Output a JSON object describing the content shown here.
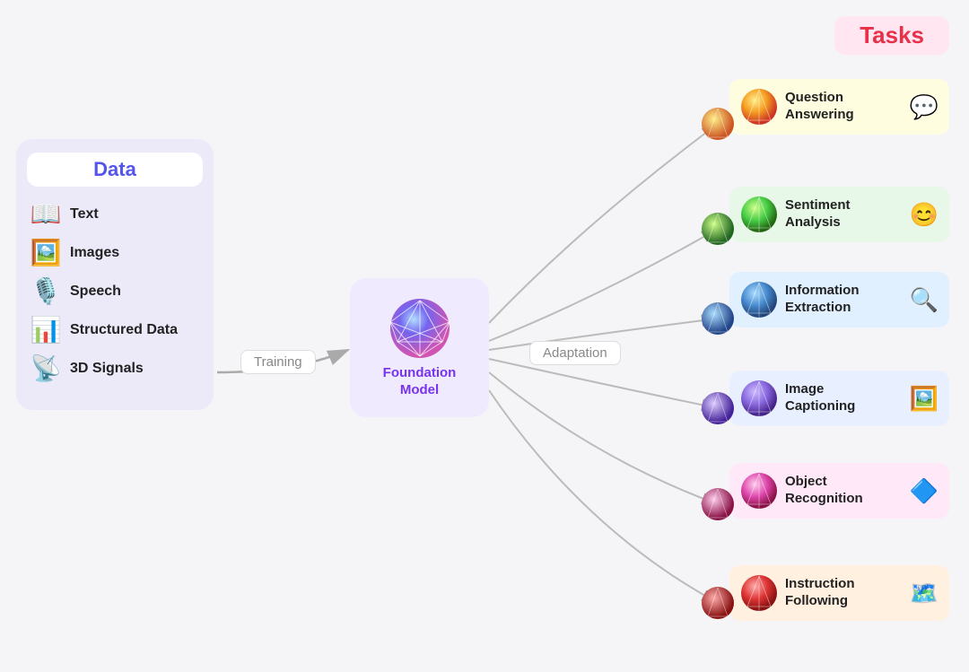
{
  "data_panel": {
    "title": "Data",
    "items": [
      {
        "label": "Text",
        "emoji": "📖"
      },
      {
        "label": "Images",
        "emoji": "🖼️"
      },
      {
        "label": "Speech",
        "emoji": "🎙️"
      },
      {
        "label": "Structured Data",
        "emoji": "📊"
      },
      {
        "label": "3D Signals",
        "emoji": "📡"
      }
    ]
  },
  "labels": {
    "training": "Training",
    "adaptation": "Adaptation",
    "foundation_model": "Foundation\nModel",
    "tasks_title": "Tasks"
  },
  "tasks": [
    {
      "id": "qa",
      "label": "Question\nAnswering",
      "emoji": "💬",
      "card_class": "card-qa",
      "sphere_color": "#f5b942"
    },
    {
      "id": "sa",
      "label": "Sentiment\nAnalysis",
      "emoji": "😊",
      "card_class": "card-sa",
      "sphere_color": "#66cc44"
    },
    {
      "id": "ie",
      "label": "Information\nExtraction",
      "emoji": "🔍",
      "card_class": "card-ie",
      "sphere_color": "#44aadd"
    },
    {
      "id": "ic",
      "label": "Image\nCaptioning",
      "emoji": "🖼️",
      "card_class": "card-ic",
      "sphere_color": "#8877ee"
    },
    {
      "id": "or",
      "label": "Object\nRecognition",
      "emoji": "🔷",
      "card_class": "card-or",
      "sphere_color": "#dd55aa"
    },
    {
      "id": "if",
      "label": "Instruction\nFollowing",
      "emoji": "🗺️",
      "card_class": "card-if",
      "sphere_color": "#dd4444"
    }
  ]
}
